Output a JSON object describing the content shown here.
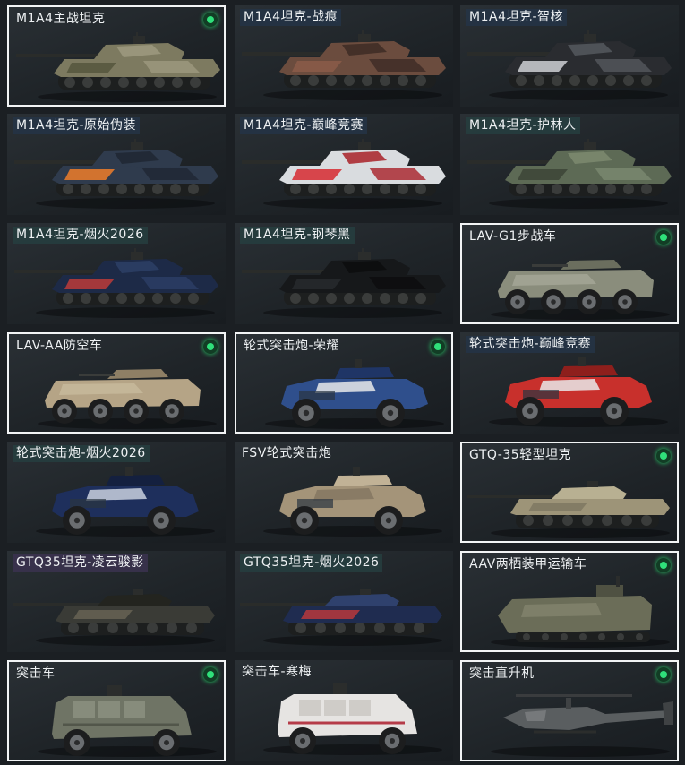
{
  "items": [
    {
      "name": "M1A4主战坦克",
      "owned": true,
      "label_style": "plain",
      "kind": "tank",
      "colors": [
        "#7d7a60",
        "#58583f",
        "#9e9a80"
      ]
    },
    {
      "name": "M1A4坦克-战痕",
      "owned": false,
      "label_style": "bg-blue",
      "kind": "tank",
      "colors": [
        "#6b4c3e",
        "#8a5b48",
        "#3d2b25"
      ]
    },
    {
      "name": "M1A4坦克-智核",
      "owned": false,
      "label_style": "bg-blue",
      "kind": "tank",
      "colors": [
        "#2a2c30",
        "#c4c7cb",
        "#55595e"
      ]
    },
    {
      "name": "M1A4坦克-原始伪装",
      "owned": false,
      "label_style": "bg-blue",
      "kind": "tank",
      "colors": [
        "#2f3b4d",
        "#e47a2c",
        "#1f2733"
      ]
    },
    {
      "name": "M1A4坦克-巅峰竞赛",
      "owned": false,
      "label_style": "bg-blue",
      "kind": "tank",
      "colors": [
        "#d9dcdf",
        "#d6343b",
        "#a82128"
      ]
    },
    {
      "name": "M1A4坦克-护林人",
      "owned": false,
      "label_style": "bg-teal",
      "kind": "tank",
      "colors": [
        "#5d6a55",
        "#3e4738",
        "#7c8a70"
      ]
    },
    {
      "name": "M1A4坦克-烟火2026",
      "owned": false,
      "label_style": "bg-teal",
      "kind": "tank",
      "colors": [
        "#1d2a47",
        "#b43a3a",
        "#2d3f66"
      ]
    },
    {
      "name": "M1A4坦克-钢琴黑",
      "owned": false,
      "label_style": "bg-teal",
      "kind": "tank",
      "colors": [
        "#16181a",
        "#26292c",
        "#0c0d0e"
      ]
    },
    {
      "name": "LAV-G1步战车",
      "owned": true,
      "label_style": "plain",
      "kind": "lav",
      "colors": [
        "#8a8d7c",
        "#6b6e5e",
        "#a9ab9b"
      ]
    },
    {
      "name": "LAV-AA防空车",
      "owned": true,
      "label_style": "plain",
      "kind": "lav",
      "colors": [
        "#b5a486",
        "#8e7f65",
        "#cbbd9f"
      ]
    },
    {
      "name": "轮式突击炮-荣耀",
      "owned": true,
      "label_style": "plain",
      "kind": "wheeled",
      "colors": [
        "#2f4f8c",
        "#e8e9ea",
        "#1f3566"
      ]
    },
    {
      "name": "轮式突击炮-巅峰竞赛",
      "owned": false,
      "label_style": "bg-blue",
      "kind": "wheeled",
      "colors": [
        "#c8302c",
        "#e9e9ea",
        "#8e1f1c"
      ]
    },
    {
      "name": "轮式突击炮-烟火2026",
      "owned": false,
      "label_style": "bg-teal",
      "kind": "wheeled",
      "colors": [
        "#1e2f5c",
        "#c9d0de",
        "#14203f"
      ]
    },
    {
      "name": "FSV轮式突击炮",
      "owned": false,
      "label_style": "plain",
      "kind": "wheeled",
      "colors": [
        "#a49479",
        "#857761",
        "#c1b296"
      ]
    },
    {
      "name": "GTQ-35轻型坦克",
      "owned": true,
      "label_style": "plain",
      "kind": "light",
      "colors": [
        "#9d9478",
        "#7d7560",
        "#b8b092"
      ]
    },
    {
      "name": "GTQ35坦克-凌云骏影",
      "owned": false,
      "label_style": "bg-purple",
      "kind": "light",
      "colors": [
        "#3a3b36",
        "#6a6556",
        "#23241f"
      ]
    },
    {
      "name": "GTQ35坦克-烟火2026",
      "owned": false,
      "label_style": "bg-teal",
      "kind": "light",
      "colors": [
        "#1f2c50",
        "#c0393b",
        "#2f416d"
      ]
    },
    {
      "name": "AAV两栖装甲运输车",
      "owned": true,
      "label_style": "plain",
      "kind": "aav",
      "colors": [
        "#6b6d58",
        "#4f5142",
        "#8a8c75"
      ]
    },
    {
      "name": "突击车",
      "owned": true,
      "label_style": "plain",
      "kind": "assault",
      "colors": [
        "#6f7465",
        "#52564a",
        "#8d9282"
      ]
    },
    {
      "name": "突击车-寒梅",
      "owned": false,
      "label_style": "plain",
      "kind": "assault",
      "colors": [
        "#e6e4e2",
        "#b53b48",
        "#c9c6c2"
      ]
    },
    {
      "name": "突击直升机",
      "owned": true,
      "label_style": "plain",
      "kind": "heli",
      "colors": [
        "#5a5e60",
        "#3f4244",
        "#76797b"
      ]
    }
  ]
}
